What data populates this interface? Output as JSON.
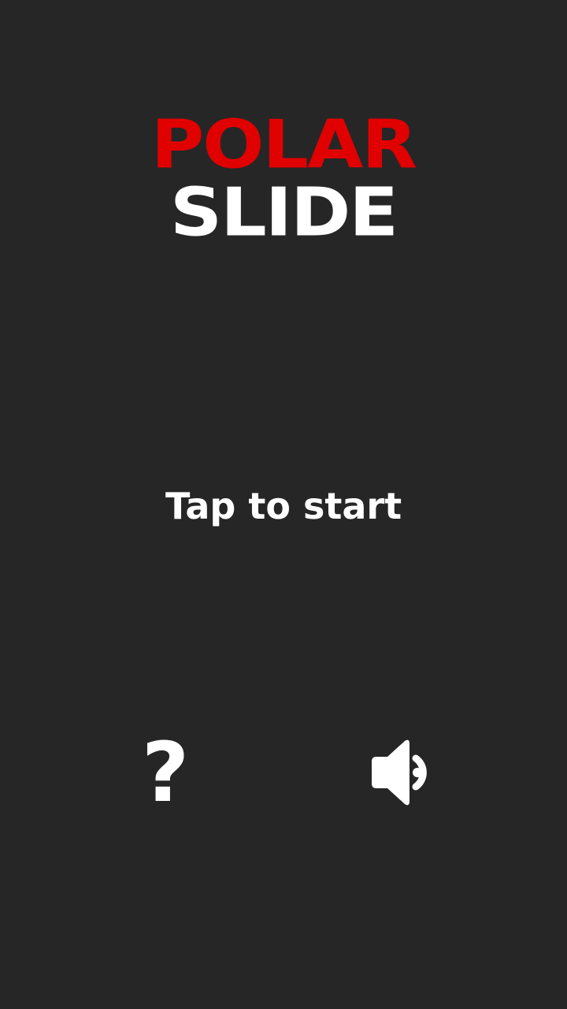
{
  "logo": {
    "line1": "POLAR",
    "line2": "SLIDE",
    "line1_color": "#e10000",
    "line2_color": "#ffffff"
  },
  "prompt": {
    "label": "Tap to start"
  },
  "controls": {
    "help": {
      "icon": "question-mark-icon",
      "glyph": "?"
    },
    "sound": {
      "icon": "speaker-icon"
    }
  },
  "colors": {
    "background": "#262626",
    "accent": "#e10000",
    "text": "#ffffff"
  }
}
